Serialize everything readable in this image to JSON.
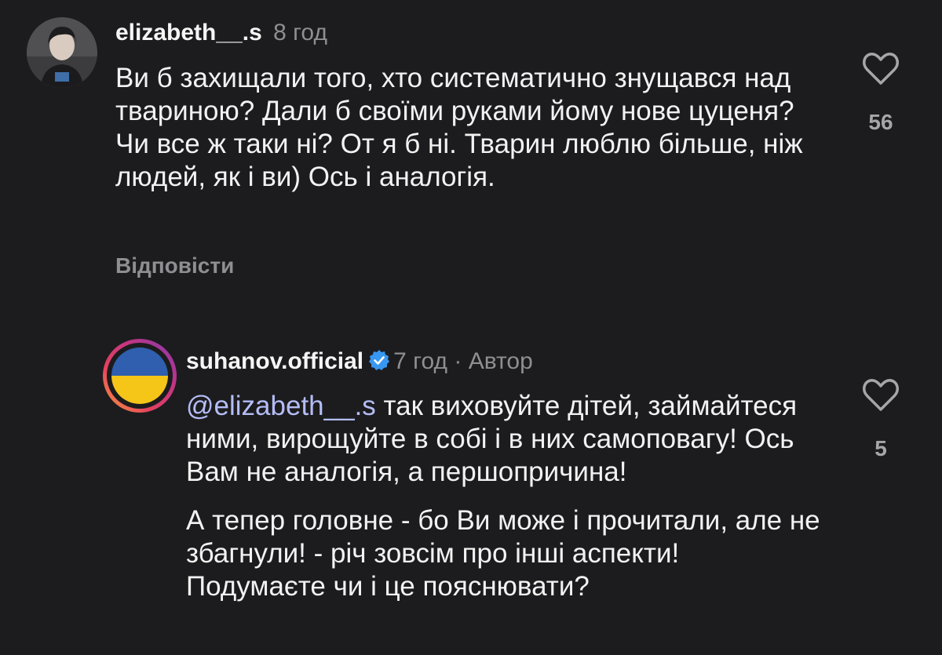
{
  "comments": [
    {
      "username": "elizabeth__.s",
      "time": "8 год",
      "text": "Ви б захищали того, хто систематично знущався над твариною? Дали б своїми руками йому нове цуценя? Чи все ж таки ні? От я б ні. Тварин люблю більше, ніж людей, як і ви) Ось і аналогія.",
      "reply_label": "Відповісти",
      "likes": "56",
      "avatar_icon": "user-photo-avatar"
    },
    {
      "username": "suhanov.official",
      "verified_icon": "verified-badge-icon",
      "time": "7 год",
      "separator": "·",
      "role": "Автор",
      "mention": "@elizabeth__.s",
      "text_p1": " так виховуйте дітей, займайтеся ними, вирощуйте в собі і в них самоповагу! Ось Вам не аналогія, а першопричина!",
      "text_p2": "А тепер головне - бо Ви може і прочитали, але не збагнули! - річ зовсім про інші аспекти! Подумаєте чи і це пояснювати?",
      "likes": "5",
      "avatar_icon": "ukraine-flag-avatar"
    }
  ],
  "colors": {
    "background": "#1c1c1e",
    "text": "#f2f2f2",
    "muted": "#8e8e93",
    "mention": "#b4bdf6",
    "verified": "#3897f0",
    "flag_blue": "#2f5fae",
    "flag_yellow": "#f5c518"
  },
  "icons": {
    "like": "heart-outline-icon"
  }
}
